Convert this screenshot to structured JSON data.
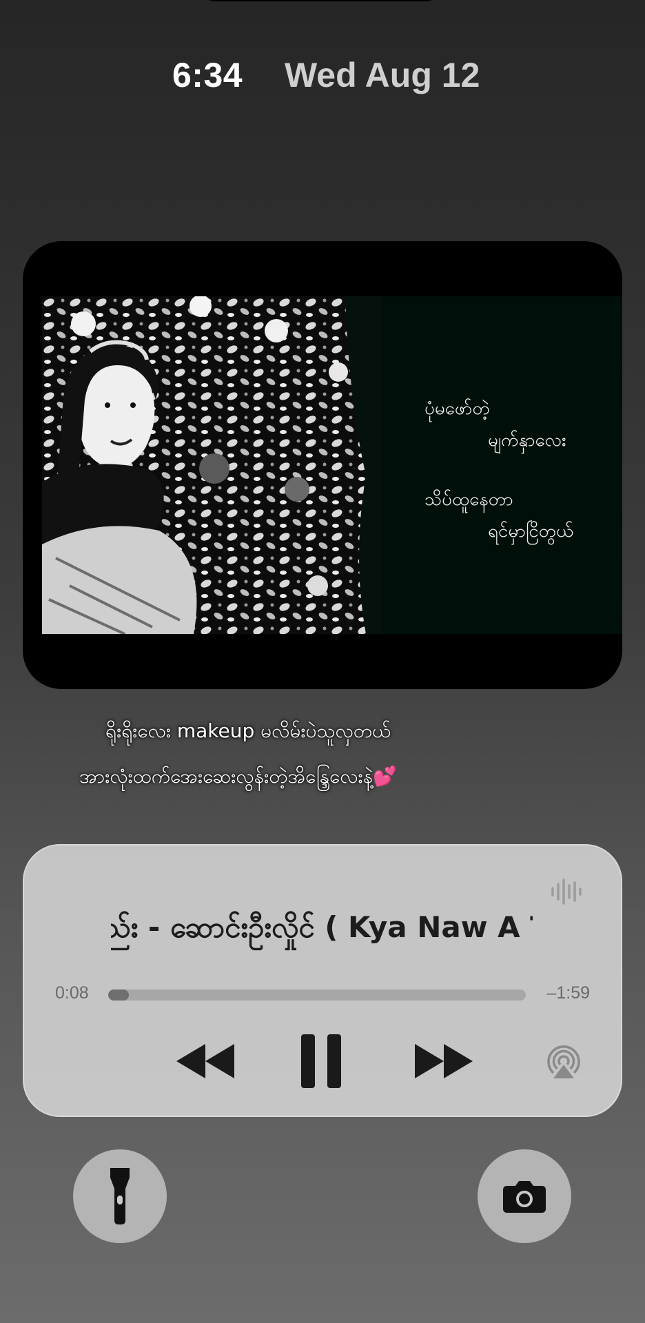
{
  "lock_screen": {
    "time": "6:34",
    "date": "Wed Aug 12"
  },
  "wallpaper": {
    "lyrics": [
      "ပုံမဖော်တဲ့",
      "မျက်နှာလေး",
      "သိပ်ထူနေတာ",
      "ရင်မှာငြိတွယ်"
    ],
    "caption": {
      "line1": "ရိုးရိုးလေး makeup မလိမ်းပဲသူလှတယ်",
      "line2": "အားလုံးထက်အေးဆေးလွန်းတဲ့အိန္ဒြေလေးနဲ့",
      "emoji": "💕"
    }
  },
  "now_playing": {
    "title": "ည်း - ဆောင်းဦးလှိုင် ( Kya Naw A Th",
    "elapsed": "0:08",
    "remaining": "–1:59",
    "progress": 0.05,
    "icons": {
      "rewind": "rewind-icon",
      "pause": "pause-icon",
      "forward": "fast-forward-icon",
      "airplay": "airplay-icon",
      "waveform": "waveform-icon"
    }
  },
  "shortcuts": {
    "left": "flashlight-icon",
    "right": "camera-icon"
  },
  "colors": {
    "progress_fill": "#6f6f6f",
    "progress_track": "#a7a7a7",
    "player_bg": "#cdcdcd",
    "heart": "#ff5fa6"
  }
}
